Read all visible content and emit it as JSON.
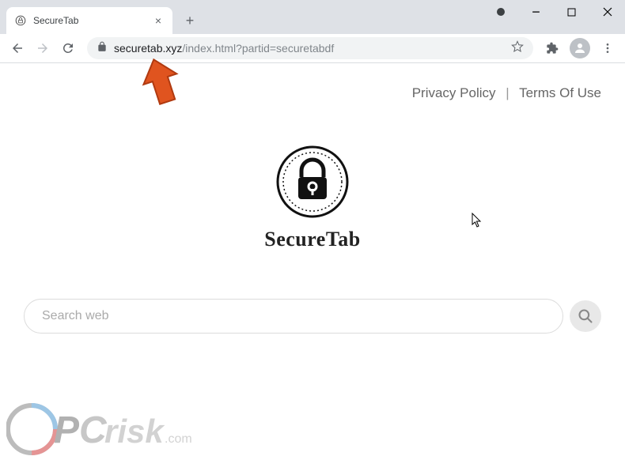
{
  "window": {
    "tab_title": "SecureTab",
    "url_domain": "securetab.xyz",
    "url_path": "/index.html?partid=securetabdf"
  },
  "page": {
    "links": {
      "privacy": "Privacy Policy",
      "separator": "|",
      "terms": "Terms Of Use"
    },
    "logo_text": "SecureTab",
    "search_placeholder": "Search web"
  },
  "watermark": {
    "p": "P",
    "c": "C",
    "risk": "risk",
    "com": ".com"
  },
  "icons": {
    "minimize": "−",
    "close_tab": "×",
    "new_tab": "+"
  }
}
